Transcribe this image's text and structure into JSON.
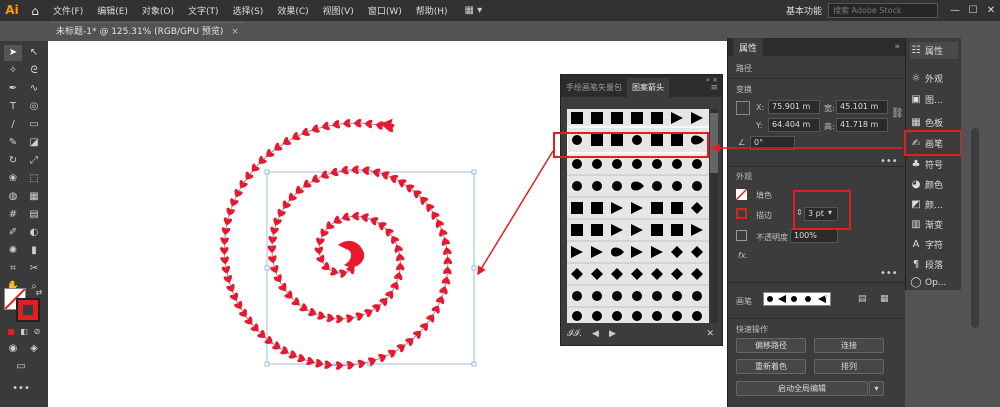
{
  "app": {
    "logo": "Ai",
    "workspace": "基本功能",
    "search_placeholder": "搜索 Adobe Stock"
  },
  "menu": [
    "文件(F)",
    "编辑(E)",
    "对象(O)",
    "文字(T)",
    "选择(S)",
    "效果(C)",
    "视图(V)",
    "窗口(W)",
    "帮助(H)"
  ],
  "document": {
    "tab_title": "未标题-1* @ 125.31% (RGB/GPU 预览)"
  },
  "brush_panel": {
    "tabs": [
      "手绘画笔矢量包",
      "图案箭头"
    ],
    "active_tab": "图案箭头"
  },
  "properties": {
    "title": "属性",
    "object_type": "路径",
    "transform_label": "变换",
    "x_label": "X:",
    "x_value": "75.901 m",
    "y_label": "Y:",
    "y_value": "64.404 m",
    "w_label": "宽:",
    "w_value": "45.101 m",
    "h_label": "高:",
    "h_value": "41.718 m",
    "angle_value": "0°",
    "appearance_label": "外观",
    "fill_label": "填色",
    "stroke_label": "描边",
    "stroke_value": "3 pt",
    "opacity_label": "不透明度",
    "opacity_value": "100%",
    "fx_label": "fx.",
    "brush_label": "画笔",
    "quick_actions_label": "快速操作",
    "btn_offset_path": "偏移路径",
    "btn_join": "连接",
    "btn_recolor": "重新着色",
    "btn_arrange": "排列",
    "btn_global_edit": "启动全局编辑"
  },
  "dock": [
    "属性",
    "外观",
    "图...",
    "色板",
    "画笔",
    "符号",
    "颜色",
    "颜...",
    "渐变",
    "字符",
    "段落",
    "Op..."
  ],
  "dock_icons": [
    "sliders-icon",
    "sun-icon",
    "image-icon",
    "grid-icon",
    "brush-icon",
    "club-icon",
    "palette-icon",
    "color-guide-icon",
    "gradient-icon",
    "type-icon",
    "paragraph-icon",
    "opentype-icon"
  ],
  "colors": {
    "accent_red": "#e02020",
    "heart_red": "#e8192c",
    "stem": "#8a8ab0"
  }
}
